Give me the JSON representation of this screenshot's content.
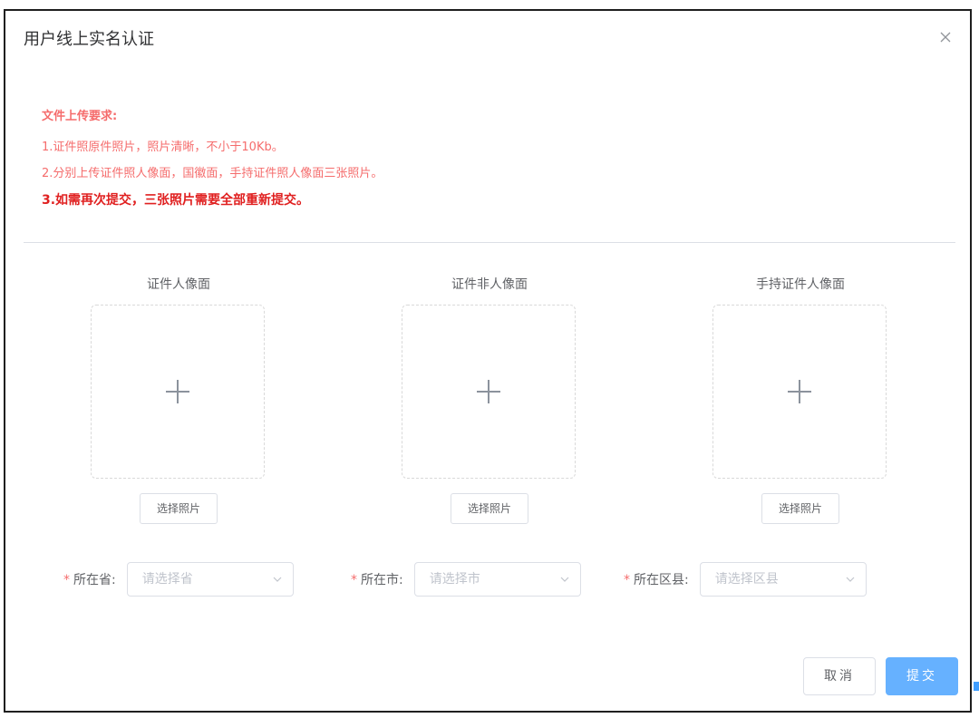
{
  "dialog": {
    "title": "用户线上实名认证",
    "close_icon": "close-icon"
  },
  "requirements": {
    "title": "文件上传要求:",
    "lines": [
      "1.证件照原件照片，照片清晰，不小于10Kb。",
      "2.分别上传证件照人像面，国徽面，手持证件照人像面三张照片。",
      "3.如需再次提交，三张照片需要全部重新提交。"
    ]
  },
  "uploads": [
    {
      "label": "证件人像面",
      "button": "选择照片",
      "icon": "plus-icon"
    },
    {
      "label": "证件非人像面",
      "button": "选择照片",
      "icon": "plus-icon"
    },
    {
      "label": "手持证件人像面",
      "button": "选择照片",
      "icon": "plus-icon"
    }
  ],
  "fields": [
    {
      "required_mark": "*",
      "label": "所在省:",
      "placeholder": "请选择省"
    },
    {
      "required_mark": "*",
      "label": "所在市:",
      "placeholder": "请选择市"
    },
    {
      "required_mark": "*",
      "label": "所在区县:",
      "placeholder": "请选择区县"
    }
  ],
  "footer": {
    "cancel_label": "取消",
    "submit_label": "提交"
  },
  "colors": {
    "warning_text": "#f56c6c",
    "strong_warning": "#e02020",
    "primary": "#66b1ff",
    "border": "#dcdfe6"
  }
}
